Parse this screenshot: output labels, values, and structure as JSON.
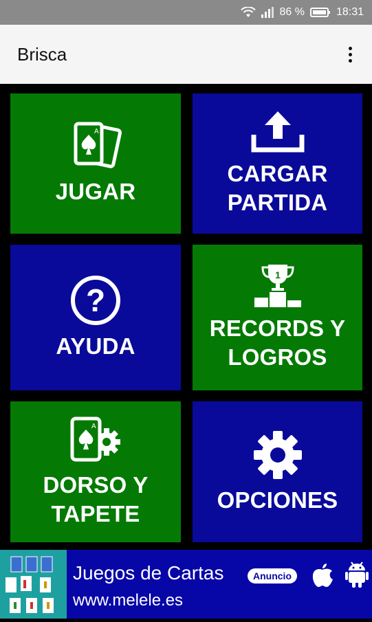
{
  "status_bar": {
    "battery": "86 %",
    "time": "18:31",
    "icons": [
      "wifi-icon",
      "signal-icon",
      "battery-icon"
    ]
  },
  "app_bar": {
    "title": "Brisca",
    "menu_icon": "more-vert-icon"
  },
  "tiles": [
    {
      "label": "JUGAR",
      "icon": "cards-icon",
      "color": "#047a04"
    },
    {
      "label": "CARGAR\nPARTIDA",
      "icon": "upload-icon",
      "color": "#0a0a9a"
    },
    {
      "label": "AYUDA",
      "icon": "help-icon",
      "color": "#0a0a9a"
    },
    {
      "label": "RECORDS Y\nLOGROS",
      "icon": "trophy-podium-icon",
      "color": "#047a04"
    },
    {
      "label": "DORSO Y\nTAPETE",
      "icon": "card-gear-icon",
      "color": "#047a04"
    },
    {
      "label": "OPCIONES",
      "icon": "gear-icon",
      "color": "#0a0a9a"
    }
  ],
  "ad": {
    "title": "Juegos de Cartas",
    "url": "www.melele.es",
    "badge": "Anuncio",
    "icons": [
      "apple-icon",
      "android-icon"
    ]
  }
}
